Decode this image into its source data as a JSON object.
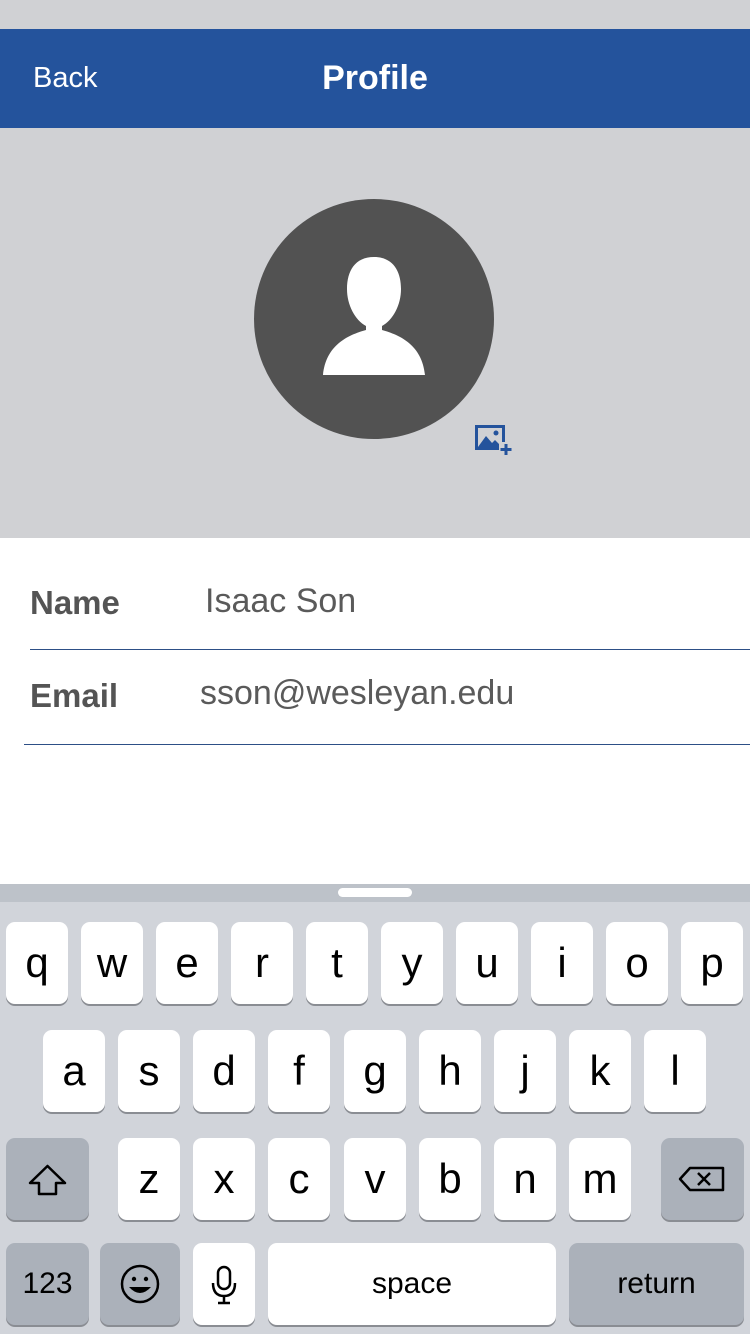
{
  "nav": {
    "back_label": "Back",
    "title": "Profile"
  },
  "avatar": {
    "icon": "person-placeholder-icon",
    "add_photo_icon": "add-photo-icon"
  },
  "form": {
    "name_label": "Name",
    "name_value": "Isaac Son",
    "email_label": "Email",
    "email_value": "sson@wesleyan.edu"
  },
  "keyboard": {
    "row1": [
      "q",
      "w",
      "e",
      "r",
      "t",
      "y",
      "u",
      "i",
      "o",
      "p"
    ],
    "row2": [
      "a",
      "s",
      "d",
      "f",
      "g",
      "h",
      "j",
      "k",
      "l"
    ],
    "row3": [
      "z",
      "x",
      "c",
      "v",
      "b",
      "n",
      "m"
    ],
    "numbers_label": "123",
    "space_label": "space",
    "return_label": "return",
    "shift_icon": "shift-icon",
    "delete_icon": "delete-icon",
    "emoji_icon": "emoji-icon",
    "mic_icon": "microphone-icon"
  },
  "colors": {
    "nav_bg": "#24539c",
    "avatar_bg": "#525252",
    "accent": "#24539c",
    "keyboard_bg": "#d1d4da"
  }
}
